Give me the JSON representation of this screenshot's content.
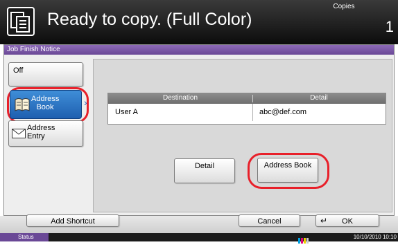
{
  "header": {
    "title": "Ready to copy. (Full Color)",
    "copies_label": "Copies",
    "copies_value": "1",
    "icon": "copy-icon"
  },
  "panel": {
    "tab_label": "Job Finish Notice"
  },
  "options": [
    {
      "label": "Off",
      "selected": false
    },
    {
      "label_line1": "Address",
      "label_line2": "Book",
      "icon": "address-book-icon",
      "selected": true
    },
    {
      "label_line1": "Address",
      "label_line2": "Entry",
      "icon": "envelope-icon",
      "selected": false
    }
  ],
  "table": {
    "columns": [
      "Destination",
      "Detail"
    ],
    "rows": [
      {
        "destination": "User A",
        "detail": "abc@def.com"
      }
    ]
  },
  "actions": {
    "detail_label": "Detail",
    "address_book_label": "Address Book"
  },
  "bottom_bar": {
    "add_shortcut_label": "Add Shortcut",
    "cancel_label": "Cancel",
    "ok_label": "OK"
  },
  "status_bar": {
    "status_label": "Status",
    "datetime": "10/10/2010  10:10"
  },
  "colors": {
    "accent": "#6a4896",
    "selected_blue": "#1e5fb0",
    "highlight_ring": "#e8202a"
  }
}
